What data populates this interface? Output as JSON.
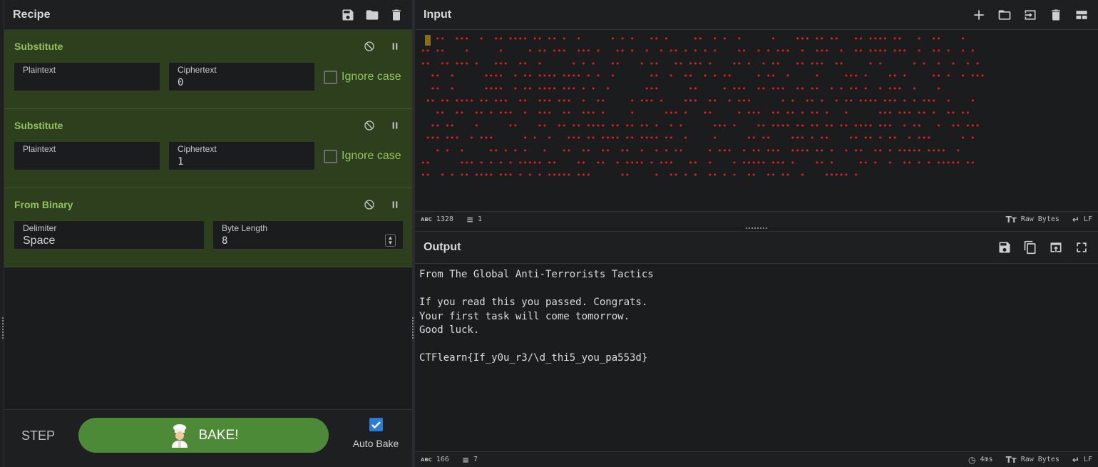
{
  "recipe": {
    "title": "Recipe",
    "icons": [
      "save-icon",
      "folder-icon",
      "trash-icon"
    ],
    "operations": [
      {
        "name": "Substitute",
        "plaintext_label": "Plaintext",
        "plaintext_value": "",
        "ciphertext_label": "Ciphertext",
        "ciphertext_value": "0",
        "ignore_case_label": "Ignore case"
      },
      {
        "name": "Substitute",
        "plaintext_label": "Plaintext",
        "plaintext_value": "",
        "ciphertext_label": "Ciphertext",
        "ciphertext_value": "1",
        "ignore_case_label": "Ignore case"
      },
      {
        "name": "From Binary",
        "delimiter_label": "Delimiter",
        "delimiter_value": "Space",
        "byte_length_label": "Byte Length",
        "byte_length_value": "8"
      }
    ],
    "step_label": "STEP",
    "bake_label": "BAKE!",
    "auto_bake_label": "Auto Bake",
    "auto_bake_checked": true
  },
  "input": {
    "title": "Input",
    "icons": [
      "plus-icon",
      "folder-icon",
      "import-icon",
      "trash-icon",
      "layout-icon"
    ],
    "dot_lines": [
      "   ••  •••  •  •• •••• •• •• •  •      • • •   •• •     ••  • •  •      •    ••• •• ••   •• •••• ••   •  ••    •",
      "•• ••    •      •     • •• •••  ••• •   •• •  •  • •• • • • •    ••  • • •••  •  •••  •  •• •••• •••  •  •• •  • •",
      "••  •• ••• •   •••  ••  •      • • •   ••    • ••   •• ••• •    •• •  • ••   •• •••  ••     • •      • •  •  •  • •",
      "  ••  •      ••••  • •• •••• •••• • •  •       ••  •  ••  • • ••     • ••  •     •     ••• •    •• •     •• •  • •••",
      "  ••  •      ••••  • •• •••• ••• • •  •       •••      ••     • •••  •• •••  •• ••  • • •• •  • •••  •    •",
      " •• •• •••• •• •••  ••  ••• •••  •  ••     • ••• •    •••  ••  • •••      • •  •• •  • •• •••• ••• • • •••  •    •",
      "   ••  ••  •• • •••  •  •••  ••  ••• •     •      ••• •   ••     • •••  •• •• • •• •   •      ••• ••• •• •  •• ••",
      "  •• ••    •      ••    ••  •• •• •••• •• •• •• •  • •      ••• •    •• •••• •• •• •• •• •••• •••  • ••   •  •• •••",
      " ••• •••  • •••      • •  •   ••• •• •••• •• •••• ••  •     •      •• ••    ••• • ••    •• •• • ••  • •••      • •",
      "   • •  •     •• • • •   •   ••  ••  ••  ••  •  • • ••     • •••  • •• •••  •••• •• •  • ••  •• • ••••• ••••  •",
      "••      ••• • • • • ••••• ••    ••  ••  • •••• • •••   ••  •    • ••••• ••• •    •• •     •• •  •  •• • • ••••• ••",
      "••  • • •• •••• ••• • • • ••••• •••      ••     •  •• • •  •• • •  ••  •• ••  •    ••••• •"
    ],
    "status": {
      "length": "1328",
      "lines": "1",
      "encoding": "Raw Bytes",
      "eol": "LF"
    }
  },
  "output": {
    "title": "Output",
    "icons": [
      "save-icon",
      "copy-icon",
      "replace-input-icon",
      "maximise-icon"
    ],
    "lines": [
      "From The Global Anti-Terrorists Tactics",
      "",
      "If you read this you passed. Congrats.",
      "Your first task will come tomorrow.",
      "Good luck.",
      "",
      "CTFlearn{If_y0u_r3/\\d_thi5_you_pa553d}"
    ],
    "status": {
      "length": "166",
      "lines": "7",
      "time": "4ms",
      "encoding": "Raw Bytes",
      "eol": "LF"
    }
  },
  "colors": {
    "operation_bg": "#2d3f1c",
    "operation_title": "#8fc45e",
    "bake_button": "#4c8a38",
    "input_dots": "#e02020",
    "checkbox_checked": "#2a7dd6"
  }
}
